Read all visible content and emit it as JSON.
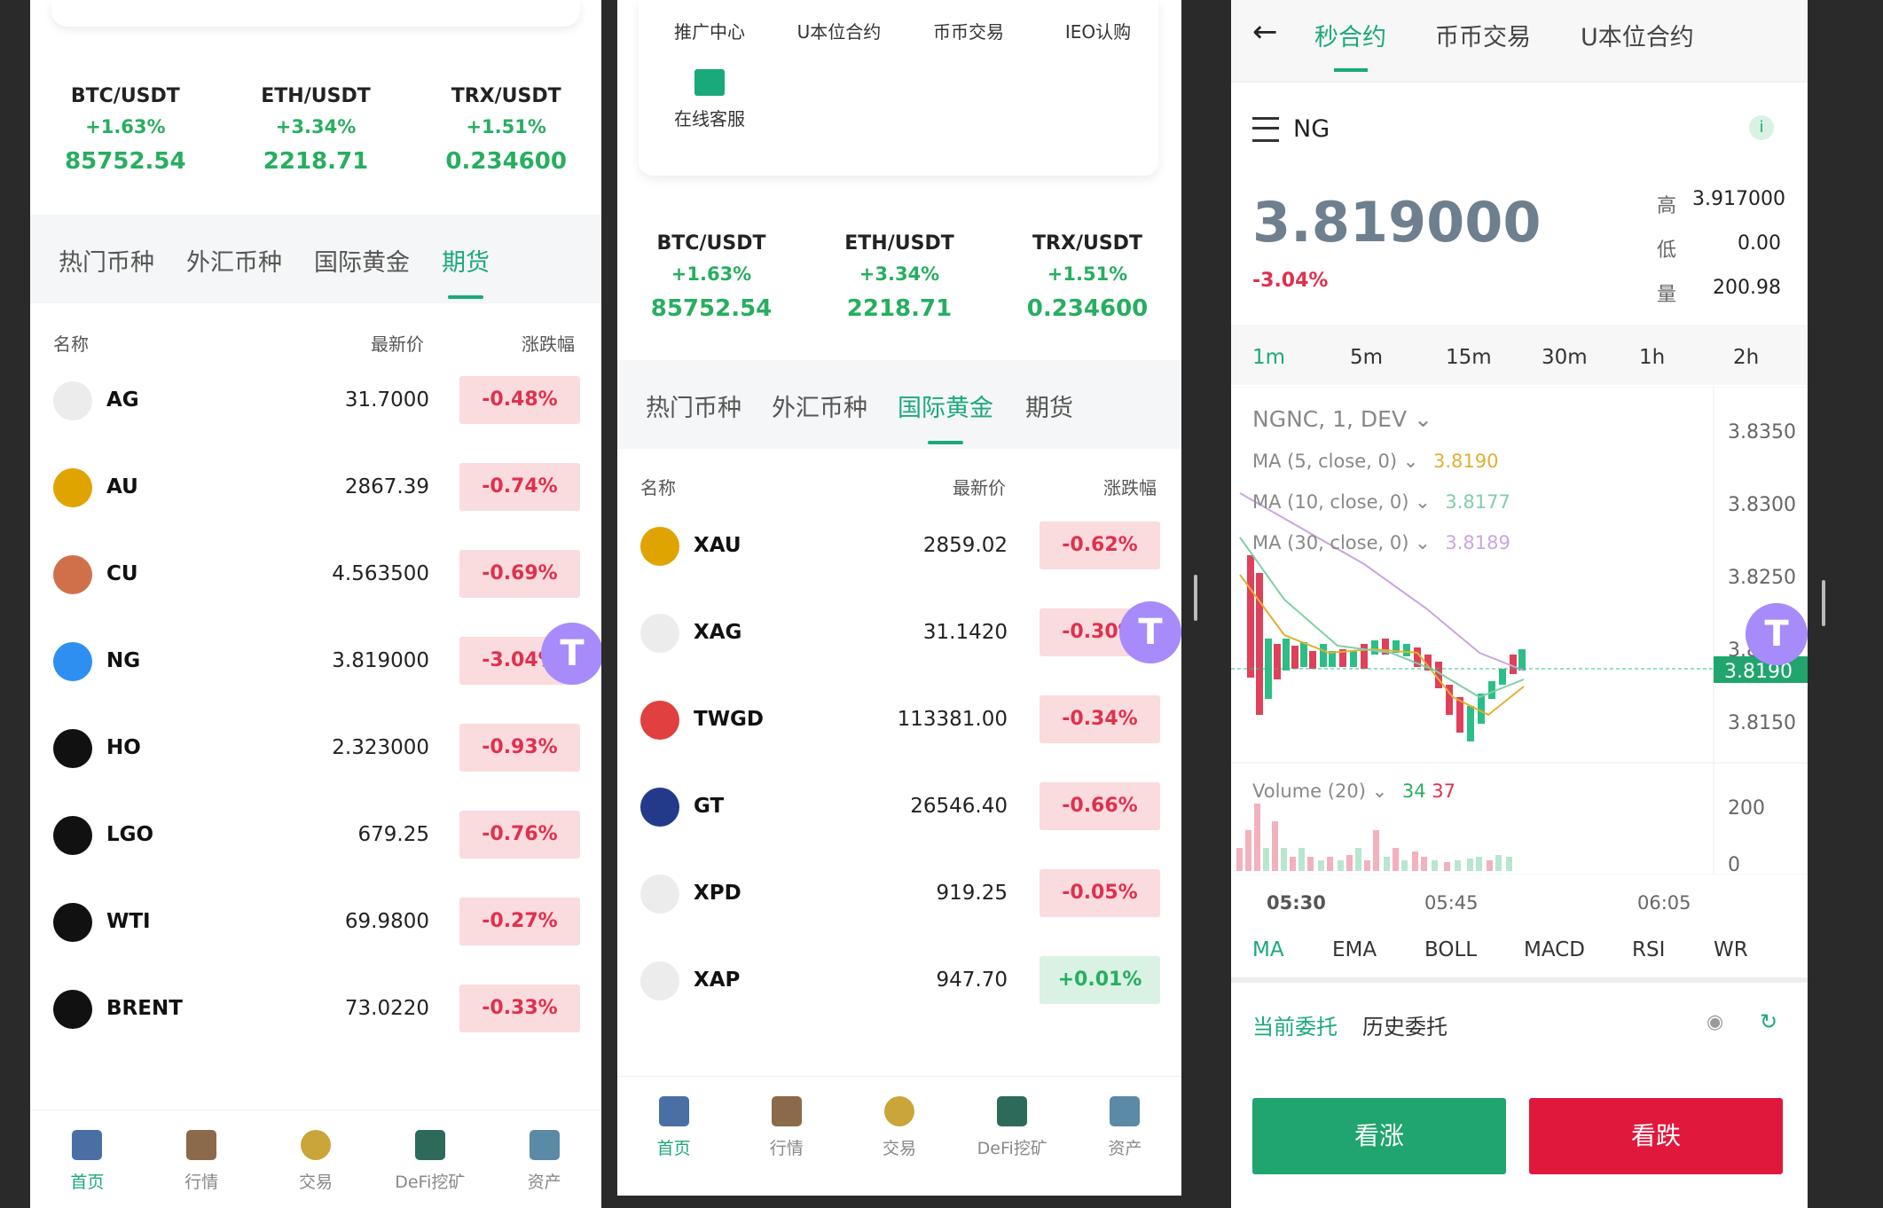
{
  "tickers": [
    {
      "pair": "BTC/USDT",
      "change": "+1.63%",
      "price": "85752.54"
    },
    {
      "pair": "ETH/USDT",
      "change": "+3.34%",
      "price": "2218.71"
    },
    {
      "pair": "TRX/USDT",
      "change": "+1.51%",
      "price": "0.234600"
    }
  ],
  "market_tabs": [
    "热门币种",
    "外汇币种",
    "国际黄金",
    "期货"
  ],
  "columns": {
    "name": "名称",
    "price": "最新价",
    "change": "涨跌幅"
  },
  "panel1": {
    "active_tab": "期货",
    "rows": [
      {
        "symbol": "AG",
        "price": "31.7000",
        "change": "-0.48%",
        "dir": "neg"
      },
      {
        "symbol": "AU",
        "price": "2867.39",
        "change": "-0.74%",
        "dir": "neg"
      },
      {
        "symbol": "CU",
        "price": "4.563500",
        "change": "-0.69%",
        "dir": "neg"
      },
      {
        "symbol": "NG",
        "price": "3.819000",
        "change": "-3.04%",
        "dir": "neg"
      },
      {
        "symbol": "HO",
        "price": "2.323000",
        "change": "-0.93%",
        "dir": "neg"
      },
      {
        "symbol": "LGO",
        "price": "679.25",
        "change": "-0.76%",
        "dir": "neg"
      },
      {
        "symbol": "WTI",
        "price": "69.9800",
        "change": "-0.27%",
        "dir": "neg"
      },
      {
        "symbol": "BRENT",
        "price": "73.0220",
        "change": "-0.33%",
        "dir": "neg"
      }
    ]
  },
  "panel2": {
    "active_tab": "国际黄金",
    "quick_menu": [
      "推广中心",
      "U本位合约",
      "币币交易",
      "IEO认购",
      "在线客服"
    ],
    "rows": [
      {
        "symbol": "XAU",
        "price": "2859.02",
        "change": "-0.62%",
        "dir": "neg"
      },
      {
        "symbol": "XAG",
        "price": "31.1420",
        "change": "-0.30%",
        "dir": "neg"
      },
      {
        "symbol": "TWGD",
        "price": "113381.00",
        "change": "-0.34%",
        "dir": "neg"
      },
      {
        "symbol": "GT",
        "price": "26546.40",
        "change": "-0.66%",
        "dir": "neg"
      },
      {
        "symbol": "XPD",
        "price": "919.25",
        "change": "-0.05%",
        "dir": "neg"
      },
      {
        "symbol": "XAP",
        "price": "947.70",
        "change": "+0.01%",
        "dir": "pos"
      }
    ]
  },
  "bottom_nav": [
    "首页",
    "行情",
    "交易",
    "DeFi挖矿",
    "资产"
  ],
  "float_label": "T",
  "detail": {
    "back": "←",
    "tabs": [
      "秒合约",
      "币币交易",
      "U本位合约"
    ],
    "symbol": "NG",
    "price": "3.819000",
    "change": "-3.04%",
    "high_label": "高",
    "high": "3.917000",
    "low_label": "低",
    "low": "0.00",
    "vol_label": "量",
    "vol": "200.98",
    "intervals": [
      "1m",
      "5m",
      "15m",
      "30m",
      "1h",
      "2h"
    ],
    "study_title": "NGNC, 1, DEV",
    "ma": [
      {
        "label": "MA (5, close, 0)",
        "value": "3.8190",
        "color": "#e0b030"
      },
      {
        "label": "MA (10, close, 0)",
        "value": "3.8177",
        "color": "#7fcfa6"
      },
      {
        "label": "MA (30, close, 0)",
        "value": "3.8189",
        "color": "#c9a6e0"
      }
    ],
    "price_axis": [
      "3.8350",
      "3.8300",
      "3.8250",
      "3.8200",
      "3.8150"
    ],
    "last_price_tag": "3.8190",
    "volume_label": "Volume (20)",
    "volume_values": [
      "34",
      "37"
    ],
    "volume_axis": [
      "200",
      "0"
    ],
    "time_axis": [
      "05:30",
      "05:45",
      "06:05"
    ],
    "indicators": [
      "MA",
      "EMA",
      "BOLL",
      "MACD",
      "RSI",
      "WR"
    ],
    "order_tabs": [
      "当前委托",
      "历史委托"
    ],
    "buy_label": "看涨",
    "sell_label": "看跌"
  }
}
